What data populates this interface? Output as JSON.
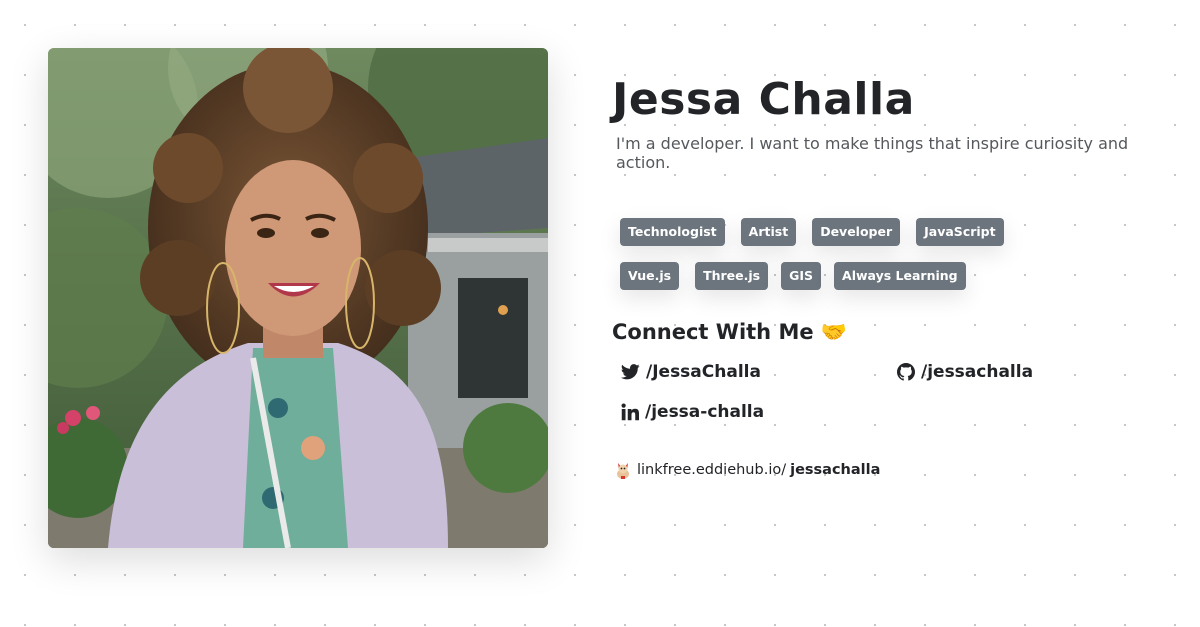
{
  "profile": {
    "name": "Jessa Challa",
    "bio": "I'm a developer. I want to make things that inspire curiosity and action."
  },
  "tags": [
    "Technologist",
    "Artist",
    "Developer",
    "JavaScript",
    "Vue.js",
    "Three.js",
    "GIS",
    "Always Learning"
  ],
  "connect": {
    "title": "Connect With Me 🤝",
    "links": [
      {
        "platform": "twitter",
        "icon": "twitter-icon",
        "handle": "/JessaChalla"
      },
      {
        "platform": "github",
        "icon": "github-icon",
        "handle": "/jessachalla"
      },
      {
        "platform": "linkedin",
        "icon": "linkedin-icon",
        "handle": "/jessa-challa"
      }
    ]
  },
  "footer": {
    "icon": "linkfree-logo-icon",
    "domain": "linkfree.eddiehub.io/",
    "username": "jessachalla"
  },
  "colors": {
    "tag_bg": "#6c757d",
    "text": "#222428",
    "muted": "#55585c"
  }
}
